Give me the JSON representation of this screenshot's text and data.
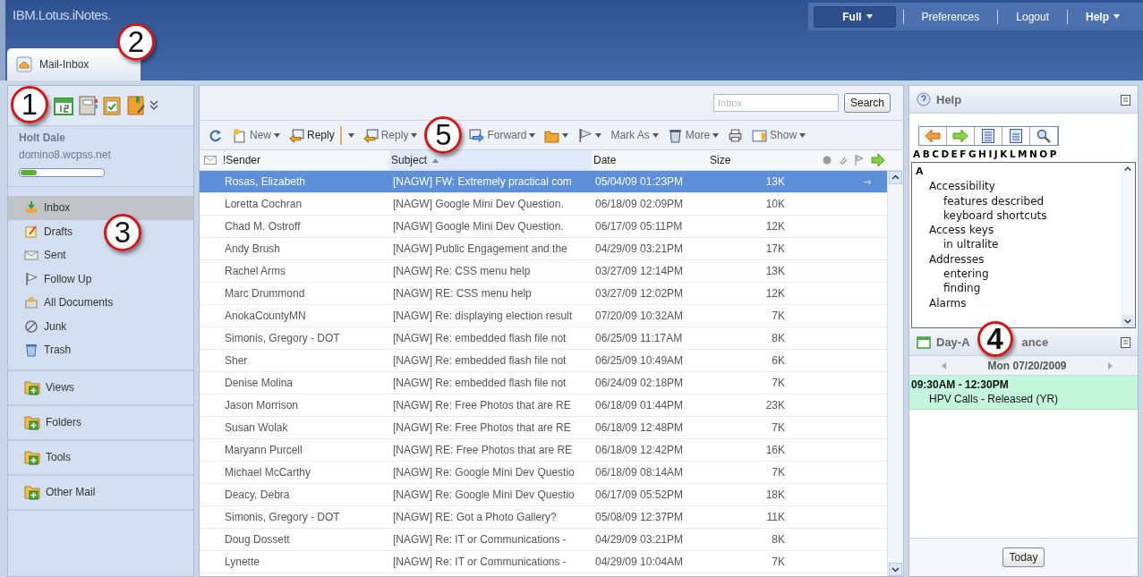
{
  "brand": "IBM.Lotus.iNotes.",
  "top_menu": [
    {
      "label": "Full",
      "kind": "dropdown",
      "selected": true
    },
    {
      "label": "Preferences",
      "kind": "link",
      "selected": false
    },
    {
      "label": "Logout",
      "kind": "link",
      "selected": false
    },
    {
      "label": "Help",
      "kind": "dropdown",
      "selected": false
    }
  ],
  "tabs": [
    {
      "label": "Mail-Inbox",
      "selected": true
    }
  ],
  "sidebar": {
    "user": "Holt Dale",
    "server": "domino8.wcpss.net",
    "quota": {
      "level": 0.2
    },
    "folders": [
      {
        "label": "Inbox",
        "selected": true
      },
      {
        "label": "Drafts",
        "selected": false
      },
      {
        "label": "Sent",
        "selected": false
      },
      {
        "label": "Follow Up",
        "selected": false
      },
      {
        "label": "All Documents",
        "selected": false
      },
      {
        "label": "Junk",
        "selected": false
      },
      {
        "label": "Trash",
        "selected": false
      }
    ],
    "sections": [
      {
        "label": "Views"
      },
      {
        "label": "Folders"
      },
      {
        "label": "Tools"
      },
      {
        "label": "Other Mail"
      }
    ]
  },
  "search": {
    "placeholder": "Inbox",
    "button": "Search"
  },
  "toolbar": [
    {
      "dropdown": false,
      "split": false
    },
    {
      "label": "New",
      "dropdown": true,
      "split": false
    },
    {
      "label": "Reply",
      "dropdown": true,
      "split": true
    },
    {
      "label": "Reply",
      "dropdown": true,
      "split": false
    },
    {
      "label": "Forward",
      "dropdown": true,
      "split": false
    },
    {
      "dropdown": true,
      "split": false
    },
    {
      "dropdown": true,
      "split": false
    },
    {
      "label": "Mark As",
      "dropdown": true,
      "split": false
    },
    {
      "label": "More",
      "dropdown": true,
      "split": false
    },
    {
      "dropdown": false,
      "split": false
    },
    {
      "label": "Show",
      "dropdown": true,
      "split": false
    }
  ],
  "table": {
    "columns": [
      {
        "label": "!Sender",
        "sorted": false
      },
      {
        "label": "Subject",
        "sorted": true
      },
      {
        "label": "Date",
        "sorted": false
      },
      {
        "label": "Size",
        "sorted": false
      }
    ],
    "rows": [
      {
        "sender": "Rosas, Elizabeth",
        "subject": "[NAGW] FW: Extremely practical com",
        "date": "05/04/09 01:23PM",
        "size": "13K",
        "selected": true,
        "forwarded": true
      },
      {
        "sender": "Loretta Cochran",
        "subject": "[NAGW] Google Mini Dev Question.",
        "date": "06/18/09 02:09PM",
        "size": "10K",
        "selected": false,
        "forwarded": false
      },
      {
        "sender": "Chad M. Ostroff",
        "subject": "[NAGW] Google Mini Dev Question.",
        "date": "06/17/09 05:11PM",
        "size": "12K",
        "selected": false,
        "forwarded": false
      },
      {
        "sender": "Andy Brush",
        "subject": "[NAGW] Public Engagement and the",
        "date": "04/29/09 03:21PM",
        "size": "17K",
        "selected": false,
        "forwarded": false
      },
      {
        "sender": "Rachel Arms",
        "subject": "[NAGW] Re: CSS menu help",
        "date": "03/27/09 12:14PM",
        "size": "13K",
        "selected": false,
        "forwarded": false
      },
      {
        "sender": "Marc Drummond",
        "subject": "[NAGW] RE: CSS menu help",
        "date": "03/27/09 12:02PM",
        "size": "12K",
        "selected": false,
        "forwarded": false
      },
      {
        "sender": "AnokaCountyMN",
        "subject": "[NAGW] Re: displaying election result",
        "date": "07/20/09 10:32AM",
        "size": "7K",
        "selected": false,
        "forwarded": false
      },
      {
        "sender": "Simonis, Gregory - DOT",
        "subject": "[NAGW] Re: embedded flash file not",
        "date": "06/25/09 11:17AM",
        "size": "8K",
        "selected": false,
        "forwarded": false
      },
      {
        "sender": "Sher",
        "subject": "[NAGW] Re: embedded flash file not",
        "date": "06/25/09 10:49AM",
        "size": "6K",
        "selected": false,
        "forwarded": false
      },
      {
        "sender": "Denise Molina",
        "subject": "[NAGW] Re: embedded flash file not",
        "date": "06/24/09 02:18PM",
        "size": "7K",
        "selected": false,
        "forwarded": false
      },
      {
        "sender": "Jason Morrison",
        "subject": "[NAGW] Re: Free Photos that are RE",
        "date": "06/18/09 01:44PM",
        "size": "23K",
        "selected": false,
        "forwarded": false
      },
      {
        "sender": "Susan Wolak",
        "subject": "[NAGW] Re: Free Photos that are RE",
        "date": "06/18/09 12:48PM",
        "size": "7K",
        "selected": false,
        "forwarded": false
      },
      {
        "sender": "Maryann Purcell",
        "subject": "[NAGW] RE: Free Photos that are RE",
        "date": "06/18/09 12:42PM",
        "size": "16K",
        "selected": false,
        "forwarded": false
      },
      {
        "sender": "Michael McCarthy",
        "subject": "[NAGW] Re: Google Mini Dev Questio",
        "date": "06/18/09 08:14AM",
        "size": "7K",
        "selected": false,
        "forwarded": false
      },
      {
        "sender": "Deacy, Debra",
        "subject": "[NAGW] Re: Google Mini Dev Questio",
        "date": "06/17/09 05:52PM",
        "size": "18K",
        "selected": false,
        "forwarded": false
      },
      {
        "sender": "Simonis, Gregory - DOT",
        "subject": "[NAGW] RE: Got a Photo Gallery?",
        "date": "05/08/09 12:37PM",
        "size": "11K",
        "selected": false,
        "forwarded": false
      },
      {
        "sender": "Doug Dossett",
        "subject": "[NAGW] Re: IT or Communications -",
        "date": "04/29/09 03:21PM",
        "size": "8K",
        "selected": false,
        "forwarded": false
      },
      {
        "sender": "Lynette",
        "subject": "[NAGW] Re: IT or Communications -",
        "date": "04/29/09 10:04AM",
        "size": "7K",
        "selected": false,
        "forwarded": false
      }
    ]
  },
  "help": {
    "title": "Help",
    "letters": [
      "A",
      "B",
      "C",
      "D",
      "E",
      "F",
      "G",
      "H",
      "I",
      "J",
      "K",
      "L",
      "M",
      "N",
      "O",
      "P"
    ],
    "index": [
      {
        "label": "A",
        "children": [
          {
            "label": "Accessibility",
            "children": [
              {
                "label": "features described"
              },
              {
                "label": "keyboard shortcuts"
              }
            ]
          },
          {
            "label": "Access keys",
            "children": [
              {
                "label": "in ultralite"
              }
            ]
          },
          {
            "label": "Addresses",
            "children": [
              {
                "label": "entering"
              },
              {
                "label": "finding"
              }
            ]
          },
          {
            "label": "Alarms"
          }
        ]
      }
    ]
  },
  "glance": {
    "title_start": "Day-A",
    "title_end": "ance",
    "date": "Mon 07/20/2009",
    "events": [
      {
        "time": "09:30AM - 12:30PM",
        "title": "HPV Calls - Released (YR)"
      }
    ],
    "button": "Today"
  },
  "callouts": [
    "1",
    "2",
    "3",
    "4",
    "5"
  ]
}
